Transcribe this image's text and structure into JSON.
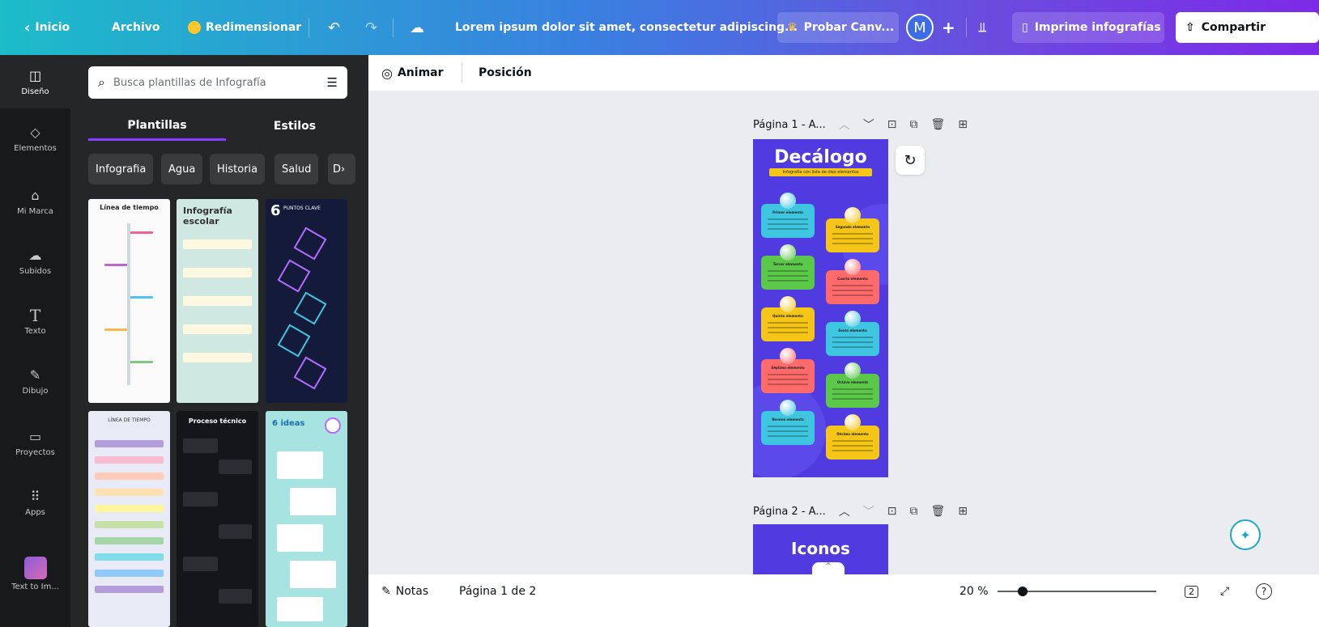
{
  "topbar": {
    "home_label": "Inicio",
    "file_label": "Archivo",
    "resize_label": "Redimensionar",
    "doc_title": "Lorem ipsum dolor sit amet, consectetur adipiscing...",
    "try_label": "Probar Canv...",
    "avatar_initial": "M",
    "add_label": "+",
    "print_label": "Imprime infografías",
    "share_label": "Compartir"
  },
  "rail": {
    "items": [
      {
        "label": "Diseño",
        "icon": "layout-icon"
      },
      {
        "label": "Elementos",
        "icon": "shapes-icon"
      },
      {
        "label": "Mi Marca",
        "icon": "brand-icon"
      },
      {
        "label": "Subidos",
        "icon": "cloud-upload-icon"
      },
      {
        "label": "Texto",
        "icon": "text-icon"
      },
      {
        "label": "Dibujo",
        "icon": "draw-icon"
      },
      {
        "label": "Proyectos",
        "icon": "folder-icon"
      },
      {
        "label": "Apps",
        "icon": "apps-grid-icon"
      },
      {
        "label": "Text to Im...",
        "icon": "text-to-image-icon"
      }
    ]
  },
  "panel": {
    "search_placeholder": "Busca plantillas de Infografía",
    "tabs": [
      "Plantillas",
      "Estilos"
    ],
    "chips": [
      "Infografia",
      "Agua",
      "Historia",
      "Salud",
      "D"
    ],
    "templates": [
      {
        "title": "Línea de tiempo"
      },
      {
        "title": "Infografía escolar"
      },
      {
        "title": "PUNTOS CLAVE",
        "number": "6"
      },
      {
        "title": "LÍNEA DE TIEMPO"
      },
      {
        "title": "Proceso técnico"
      },
      {
        "title": "6 ideas"
      }
    ]
  },
  "editbar": {
    "animate_label": "Animar",
    "position_label": "Posición"
  },
  "canvas": {
    "page1_label": "Página 1 - A...",
    "page2_label": "Página 2 - A...",
    "page1_title": "Decálogo",
    "page1_subtitle": "Infografía con lista de diez elementos",
    "page2_title": "Iconos",
    "cards": [
      {
        "label": "Primer elemento",
        "color": "#3ec6e0"
      },
      {
        "label": "Segundo elemento",
        "color": "#f5c518"
      },
      {
        "label": "Tercer elemento",
        "color": "#5bc84a"
      },
      {
        "label": "Cuarto elemento",
        "color": "#ff6b6b"
      },
      {
        "label": "Quinto elemento",
        "color": "#f5c518"
      },
      {
        "label": "Sexto elemento",
        "color": "#3ec6e0"
      },
      {
        "label": "Séptimo elemento",
        "color": "#ff6b6b"
      },
      {
        "label": "Octavo elemento",
        "color": "#5bc84a"
      },
      {
        "label": "Noveno elemento",
        "color": "#3ec6e0"
      },
      {
        "label": "Décimo elemento",
        "color": "#f5c518"
      }
    ]
  },
  "bottom": {
    "notes_label": "Notas",
    "page_indicator": "Página 1 de 2",
    "zoom": "20 %",
    "zoom_fraction": 0.16,
    "pages_count": "2"
  },
  "colors": {
    "accent": "#8b3dff",
    "page_bg": "#4f3be0"
  }
}
